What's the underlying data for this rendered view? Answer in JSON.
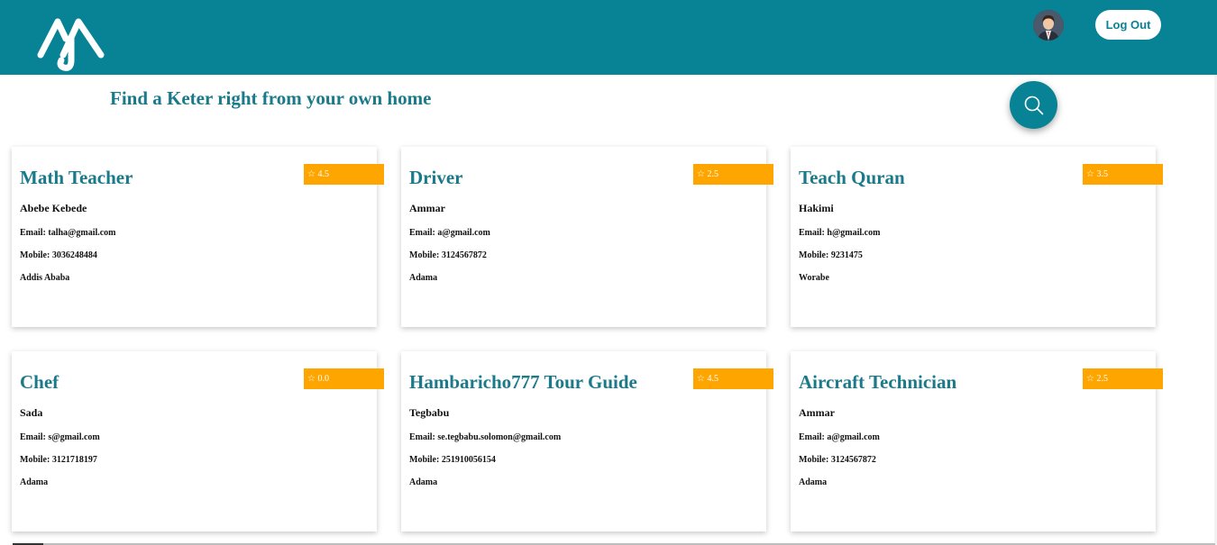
{
  "header": {
    "brand_color": "#088395",
    "logo_icon": "logo-icon",
    "avatar_icon": "user-avatar-icon",
    "logout_label": "Log Out"
  },
  "hero": {
    "tagline": "Find a Keter right from your own home",
    "search_icon": "search-icon"
  },
  "rating_color": "#ffa500",
  "cards": [
    {
      "title": "Math Teacher",
      "rating": "☆ 4.5",
      "name": "Abebe Kebede",
      "email": "Email: talha@gmail.com",
      "mobile": "Mobile: 3036248484",
      "city": "Addis Ababa"
    },
    {
      "title": "Driver",
      "rating": "☆ 2.5",
      "name": "Ammar",
      "email": "Email: a@gmail.com",
      "mobile": "Mobile: 3124567872",
      "city": "Adama"
    },
    {
      "title": "Teach Quran",
      "rating": "☆ 3.5",
      "name": "Hakimi",
      "email": "Email: h@gmail.com",
      "mobile": "Mobile: 9231475",
      "city": "Worabe"
    },
    {
      "title": "Chef",
      "rating": "☆ 0.0",
      "name": "Sada",
      "email": "Email: s@gmail.com",
      "mobile": "Mobile: 3121718197",
      "city": "Adama"
    },
    {
      "title": "Hambaricho777 Tour Guide",
      "rating": "☆ 4.5",
      "name": "Tegbabu",
      "email": "Email: se.tegbabu.solomon@gmail.com",
      "mobile": "Mobile: 251910056154",
      "city": "Adama"
    },
    {
      "title": "Aircraft Technician",
      "rating": "☆ 2.5",
      "name": "Ammar",
      "email": "Email: a@gmail.com",
      "mobile": "Mobile: 3124567872",
      "city": "Adama"
    }
  ]
}
